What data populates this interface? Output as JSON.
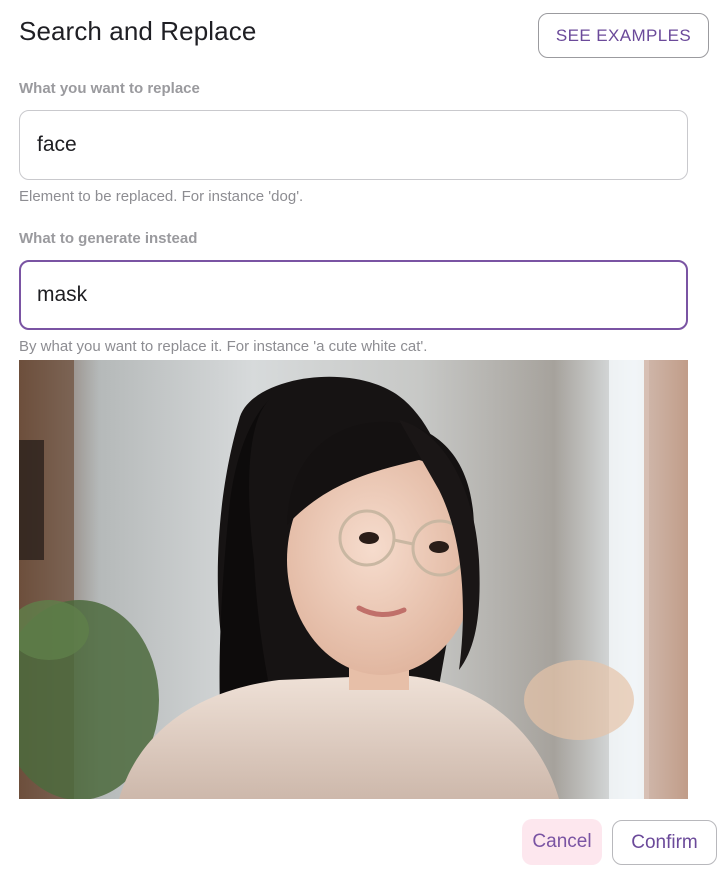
{
  "dialog": {
    "title": "Search and Replace",
    "see_examples_label": "SEE EXAMPLES"
  },
  "replace_field": {
    "label": "What you want to replace",
    "value": "face",
    "helper": "Element to be replaced. For instance 'dog'."
  },
  "generate_field": {
    "label": "What to generate instead",
    "value": "mask",
    "helper": "By what you want to replace it. For instance 'a cute white cat'."
  },
  "colors": {
    "accent": "#7a54a3",
    "cancel_bg": "#fde7ee"
  },
  "actions": {
    "cancel_label": "Cancel",
    "confirm_label": "Confirm"
  }
}
